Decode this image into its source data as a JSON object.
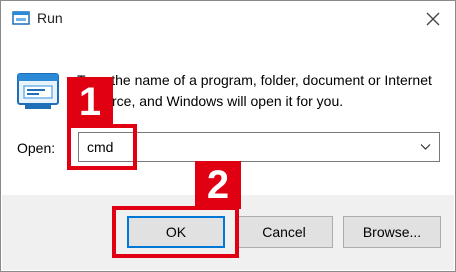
{
  "window": {
    "title": "Run",
    "icons": {
      "app": "run-app-icon",
      "close": "close-icon",
      "large": "run-program-icon"
    }
  },
  "description": "Type the name of a program, folder, document or Internet resource, and Windows will open it for you.",
  "open_field": {
    "label": "Open:",
    "value": "cmd",
    "dropdown_icon": "chevron-down-icon"
  },
  "buttons": {
    "ok": "OK",
    "cancel": "Cancel",
    "browse": "Browse..."
  },
  "annotations": {
    "step1": "1",
    "step2": "2",
    "color": "#e00012"
  },
  "colors": {
    "accent": "#0078d7",
    "footer": "#f0f0f0"
  }
}
